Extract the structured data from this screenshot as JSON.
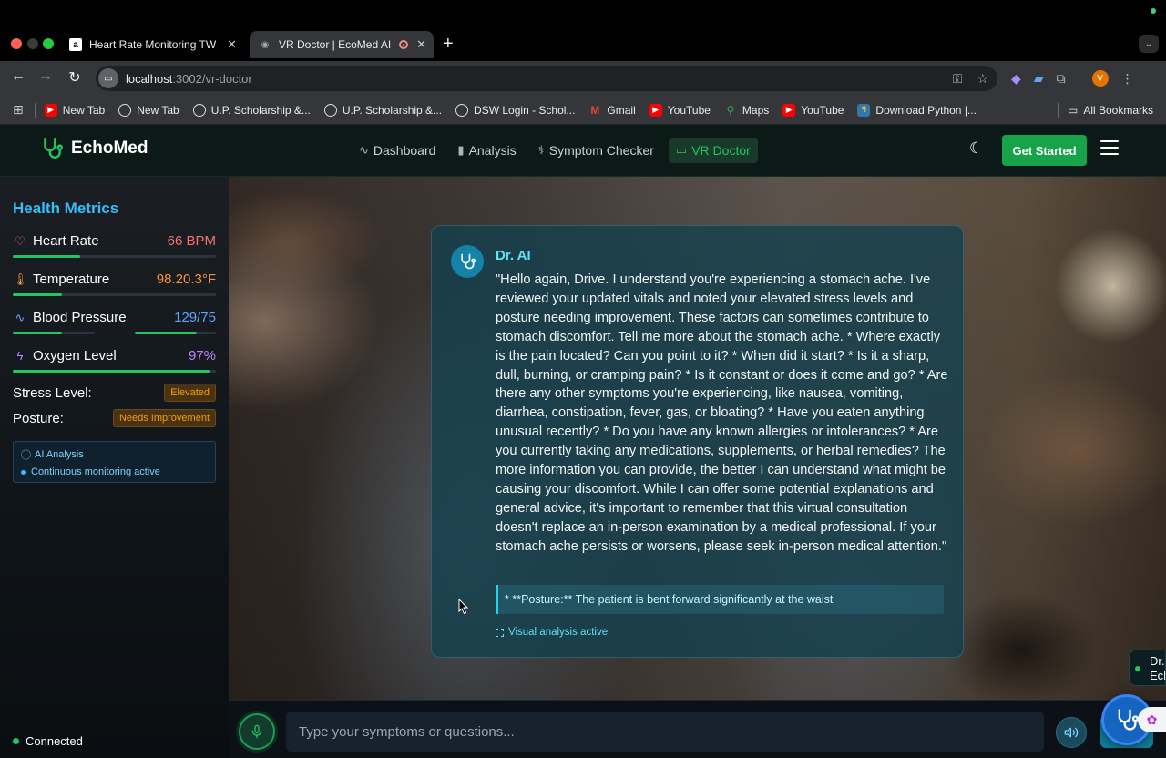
{
  "browser": {
    "tabs": [
      {
        "title": "Heart Rate Monitoring TWS E",
        "favicon": "a"
      },
      {
        "title": "VR Doctor | EcoMed AI"
      }
    ],
    "url_host": "localhost",
    "url_path": ":3002/vr-doctor",
    "profile_initial": "V",
    "bookmarks": [
      {
        "label": "New Tab",
        "icon": "youtube-icon"
      },
      {
        "label": "New Tab",
        "icon": "globe-icon"
      },
      {
        "label": "U.P. Scholarship &...",
        "icon": "globe-icon"
      },
      {
        "label": "U.P. Scholarship &...",
        "icon": "globe-icon"
      },
      {
        "label": "DSW Login - Schol...",
        "icon": "globe-icon"
      },
      {
        "label": "Gmail",
        "icon": "gmail-icon"
      },
      {
        "label": "YouTube",
        "icon": "youtube-icon"
      },
      {
        "label": "Maps",
        "icon": "maps-icon"
      },
      {
        "label": "YouTube",
        "icon": "youtube-icon"
      },
      {
        "label": "Download Python |...",
        "icon": "python-icon"
      }
    ],
    "all_bookmarks": "All Bookmarks"
  },
  "header": {
    "brand": "EchoMed",
    "nav": [
      {
        "label": "Dashboard",
        "icon": "activity-icon"
      },
      {
        "label": "Analysis",
        "icon": "bar-chart-icon"
      },
      {
        "label": "Symptom Checker",
        "icon": "stethoscope-icon"
      },
      {
        "label": "VR Doctor",
        "icon": "video-icon",
        "active": true
      }
    ],
    "cta": "Get Started"
  },
  "sidebar": {
    "title": "Health Metrics",
    "metrics": [
      {
        "label": "Heart Rate",
        "value": "66 BPM",
        "color": "#f87171",
        "icon": "heart-icon",
        "level": 0.33
      },
      {
        "label": "Temperature",
        "value": "98.20.3°F",
        "color": "#fb923c",
        "icon": "thermometer-icon",
        "level": 0.24
      },
      {
        "label": "Blood Pressure",
        "value": "129/75",
        "color": "#60a5fa",
        "icon": "pulse-icon",
        "level": 0.76
      },
      {
        "label": "Oxygen Level",
        "value": "97%",
        "color": "#c084fc",
        "icon": "bolt-icon",
        "level": 0.97
      }
    ],
    "stress_label": "Stress Level:",
    "stress_value": "Elevated",
    "posture_label": "Posture:",
    "posture_value": "Needs Improvement",
    "ai_title": "AI Analysis",
    "ai_status": "Continuous monitoring active",
    "connection": "Connected"
  },
  "chat": {
    "doctor_name": "Dr. AI",
    "message": "\"Hello again, Drive. I understand you're experiencing a stomach ache. I've reviewed your updated vitals and noted your elevated stress levels and posture needing improvement. These factors can sometimes contribute to stomach discomfort. Tell me more about the stomach ache. * Where exactly is the pain located? Can you point to it? * When did it start? * Is it a sharp, dull, burning, or cramping pain? * Is it constant or does it come and go? * Are there any other symptoms you're experiencing, like nausea, vomiting, diarrhea, constipation, fever, gas, or bloating? * Have you eaten anything unusual recently? * Do you have any known allergies or intolerances? * Are you currently taking any medications, supplements, or herbal remedies? The more information you can provide, the better I can understand what might be causing your discomfort. While I can offer some potential explanations and general advice, it's important to remember that this virtual consultation doesn't replace an in-person examination by a medical professional. If your stomach ache persists or worsens, please seek in-person medical attention.\"",
    "observation": "* **Posture:** The patient is bent forward significantly at the waist",
    "visual_status": "Visual analysis active"
  },
  "pill": {
    "line1": "Dr.",
    "line2": "Ech"
  },
  "input": {
    "placeholder": "Type your symptoms or questions..."
  }
}
